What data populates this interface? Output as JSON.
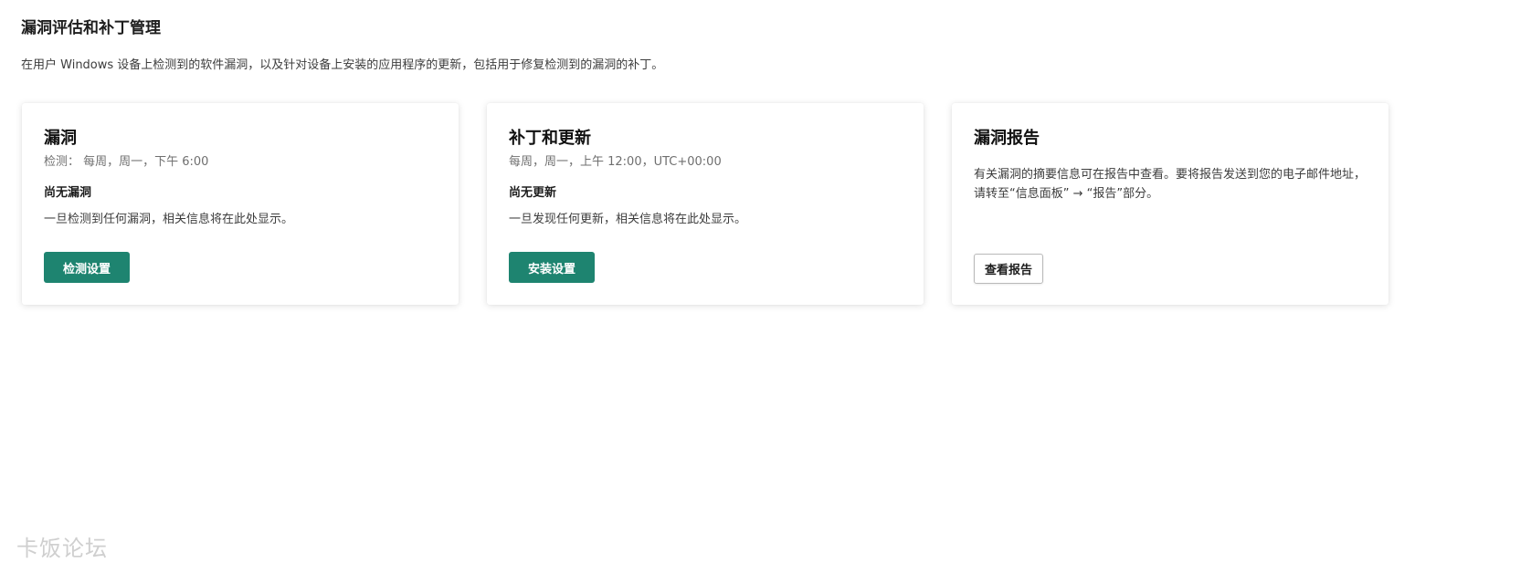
{
  "header": {
    "title": "漏洞评估和补丁管理",
    "description": "在用户 Windows 设备上检测到的软件漏洞，以及针对设备上安装的应用程序的更新，包括用于修复检测到的漏洞的补丁。"
  },
  "cards": [
    {
      "title": "漏洞",
      "schedule": "检测： 每周，周一，下午 6:00",
      "subtitle": "尚无漏洞",
      "body": "一旦检测到任何漏洞，相关信息将在此处显示。",
      "button_label": "检测设置"
    },
    {
      "title": "补丁和更新",
      "schedule": "每周，周一，上午 12:00，UTC+00:00",
      "subtitle": "尚无更新",
      "body": "一旦发现任何更新，相关信息将在此处显示。",
      "button_label": "安装设置"
    },
    {
      "title": "漏洞报告",
      "body": "有关漏洞的摘要信息可在报告中查看。要将报告发送到您的电子邮件地址，请转至“信息面板” → “报告”部分。",
      "button_label": "查看报告"
    }
  ],
  "watermark": "卡饭论坛",
  "colors": {
    "primary_button": "#1e8470",
    "primary_button_text": "#ffffff"
  }
}
